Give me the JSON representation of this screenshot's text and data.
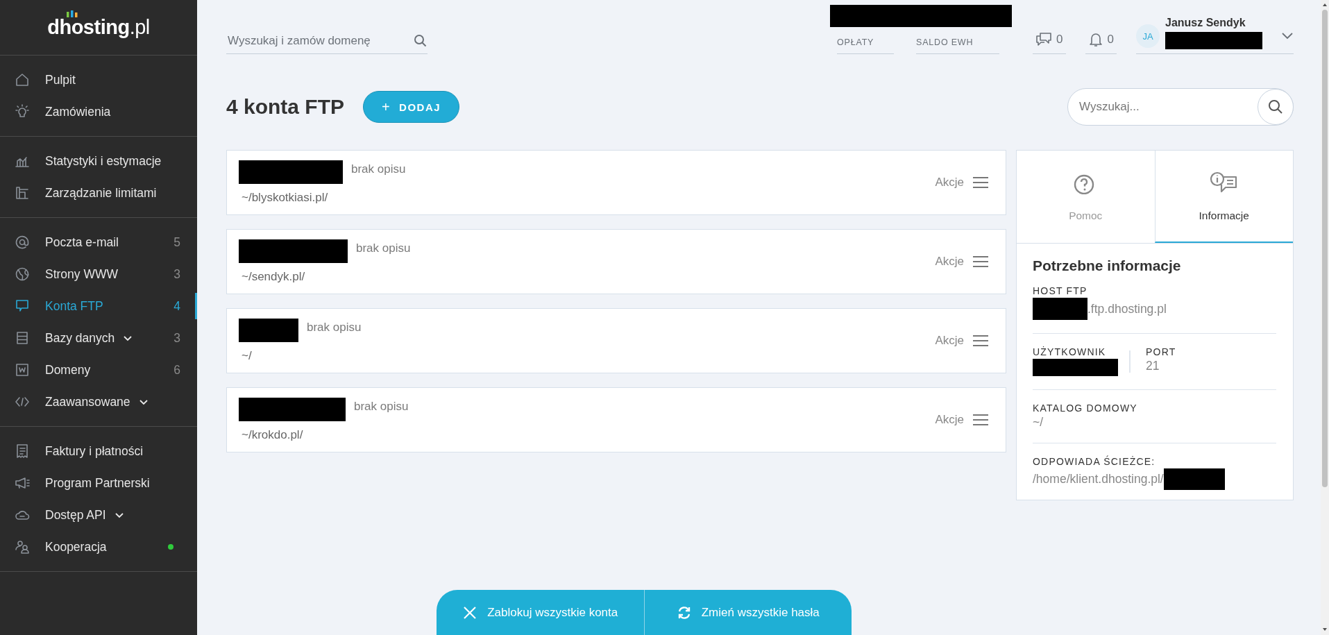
{
  "sidebar": {
    "logo": "**dhosting**.pl",
    "groups": [
      [
        {
          "label": "Pulpit",
          "selected": false,
          "has_submenu": false,
          "status_dot": false
        },
        {
          "label": "Zamówienia",
          "selected": false,
          "has_submenu": false,
          "status_dot": false
        }
      ],
      [
        {
          "label": "Statystyki i estymacje",
          "selected": false,
          "has_submenu": false,
          "status_dot": false
        },
        {
          "label": "Zarządzanie limitami",
          "selected": false,
          "has_submenu": false,
          "status_dot": false
        }
      ],
      [
        {
          "label": "Poczta e-mail",
          "count": "5",
          "selected": false,
          "has_submenu": false,
          "status_dot": false
        },
        {
          "label": "Strony WWW",
          "count": "3",
          "selected": false,
          "has_submenu": false,
          "status_dot": false
        },
        {
          "label": "Konta FTP",
          "count": "4",
          "selected": true,
          "has_submenu": false,
          "status_dot": false
        },
        {
          "label": "Bazy danych",
          "count": "3",
          "selected": false,
          "has_submenu": true,
          "status_dot": false
        },
        {
          "label": "Domeny",
          "count": "6",
          "selected": false,
          "has_submenu": false,
          "status_dot": false
        },
        {
          "label": "Zaawansowane",
          "selected": false,
          "has_submenu": true,
          "status_dot": false
        }
      ],
      [
        {
          "label": "Faktury i płatności",
          "selected": false,
          "has_submenu": false,
          "status_dot": false
        },
        {
          "label": "Program Partnerski",
          "selected": false,
          "has_submenu": false,
          "status_dot": false
        },
        {
          "label": "Dostęp API",
          "selected": false,
          "has_submenu": true,
          "status_dot": false
        },
        {
          "label": "Kooperacja",
          "selected": false,
          "has_submenu": false,
          "status_dot": true
        }
      ]
    ]
  },
  "top_bar": {
    "search": {
      "placeholder": "Wyszukaj i zamów domenę"
    },
    "balances": [
      "OPŁATY",
      "SALDO EWH"
    ],
    "messages_count": "0",
    "notifications_count": "0",
    "user": {
      "initials": "JA",
      "name": "Janusz Sendyk"
    }
  },
  "page": {
    "title": "4 konta FTP",
    "add_button": {
      "icon": "+",
      "label": "DODAJ"
    },
    "search": {
      "placeholder": "Wyszukaj..."
    }
  },
  "accounts": [
    {
      "description": "brak opisu",
      "path": "~/blyskotkiasi.pl/",
      "actions": "Akcje"
    },
    {
      "description": "brak opisu",
      "path": "~/sendyk.pl/",
      "actions": "Akcje"
    },
    {
      "description": "brak opisu",
      "path": "~/",
      "actions": "Akcje"
    },
    {
      "description": "brak opisu",
      "path": "~/krokdo.pl/",
      "actions": "Akcje"
    }
  ],
  "side_panel": {
    "tabs": [
      {
        "label": "Pomoc",
        "selected": false
      },
      {
        "label": "Informacje",
        "selected": true
      }
    ],
    "title": "Potrzebne informacje",
    "host": {
      "label": "HOST FTP",
      "value": ".ftp.dhosting.pl"
    },
    "user": {
      "label": "UŻYTKOWNIK"
    },
    "port": {
      "label": "PORT",
      "value": "21"
    },
    "home": {
      "label": "KATALOG DOMOWY",
      "value": "~/"
    },
    "path": {
      "label": "ODPOWIADA ŚCIEŻCE:",
      "value": "/home/klient.dhosting.pl/"
    }
  },
  "bottom_actions": [
    {
      "label": "Zablokuj wszystkie konta"
    },
    {
      "label": "Zmień wszystkie hasła"
    }
  ]
}
